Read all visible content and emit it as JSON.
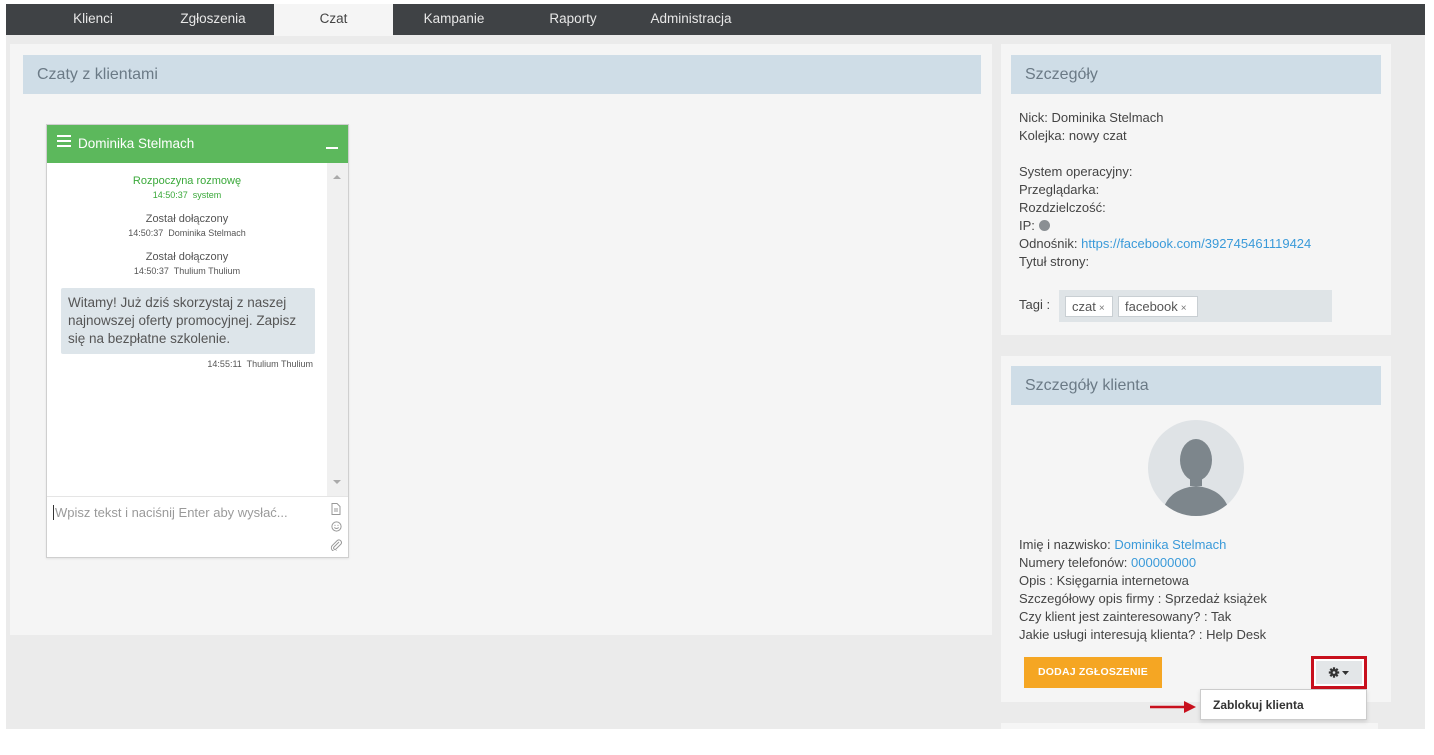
{
  "nav": {
    "tabs": [
      {
        "label": "Klienci"
      },
      {
        "label": "Zgłoszenia"
      },
      {
        "label": "Czat"
      },
      {
        "label": "Kampanie"
      },
      {
        "label": "Raporty"
      },
      {
        "label": "Administracja"
      }
    ],
    "active_tab": "Czat"
  },
  "chats": {
    "title": "Czaty z klientami",
    "window": {
      "contact_name": "Dominika Stelmach",
      "messages": [
        {
          "text": "Rozpoczyna rozmowę",
          "time": "14:50:37",
          "author": "system"
        },
        {
          "text": "Został dołączony",
          "time": "14:50:37",
          "author": "Dominika Stelmach"
        },
        {
          "text": "Został dołączony",
          "time": "14:50:37",
          "author": "Thulium Thulium"
        }
      ],
      "bubble": {
        "text": "Witamy! Już dziś skorzystaj z naszej najnowszej oferty promocyjnej. Zapisz się na bezpłatne szkolenie.",
        "time": "14:55:11",
        "author": "Thulium Thulium"
      },
      "input_placeholder": "Wpisz tekst i naciśnij Enter aby wysłać..."
    }
  },
  "details": {
    "title": "Szczegóły",
    "nick": "Nick: Dominika Stelmach",
    "queue": "Kolejka: nowy czat",
    "os": "System operacyjny:",
    "browser": "Przeglądarka:",
    "resolution": "Rozdzielczość:",
    "ip": "IP:",
    "referrer_label": "Odnośnik:",
    "referrer_url": "https://facebook.com/392745461119424",
    "page_title": "Tytuł strony:",
    "tags_label": "Tagi :",
    "tags": [
      "czat",
      "facebook"
    ]
  },
  "client": {
    "title": "Szczegóły klienta",
    "name_label": "Imię i nazwisko:",
    "name_value": "Dominika Stelmach",
    "phone_label": "Numery telefonów:",
    "phone_value": "000000000",
    "desc": "Opis : Księgarnia internetowa",
    "company_desc": "Szczegółowy opis firmy : Sprzedaż książek",
    "interested": "Czy klient jest zainteresowany? : Tak",
    "services": "Jakie usługi interesują klienta? : Help Desk",
    "add_button": "DODAJ ZGŁOSZENIE",
    "dropdown_item": "Zablokuj klienta"
  },
  "colors": {
    "nav_bg": "#3f4245",
    "chat_header": "#5cb85c",
    "panel_header": "#cfdde7",
    "link": "#3a9ad9",
    "add_button": "#f5a623",
    "highlight": "#c8101d"
  }
}
